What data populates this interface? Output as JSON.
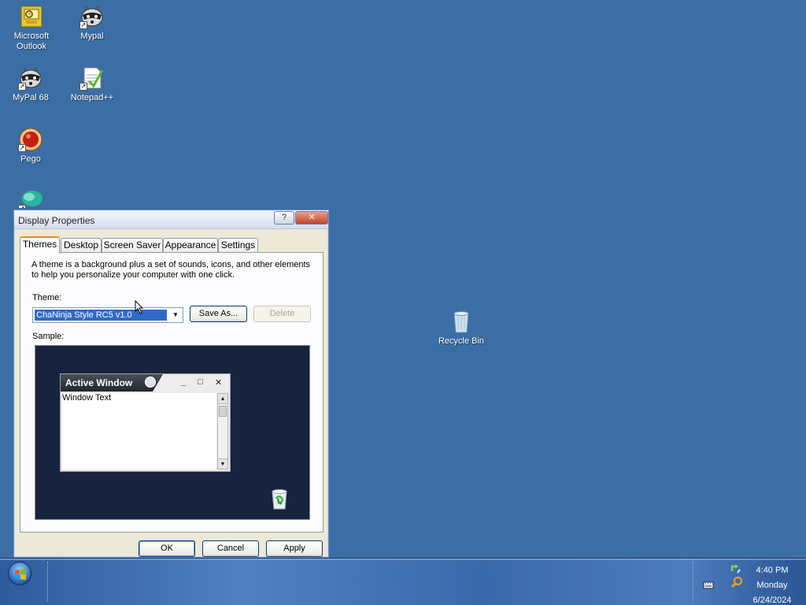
{
  "desktop": {
    "icons": [
      {
        "label_line1": "Microsoft",
        "label_line2": "Outlook"
      },
      {
        "label_line1": "Mypal",
        "label_line2": ""
      },
      {
        "label_line1": "MyPal 68",
        "label_line2": ""
      },
      {
        "label_line1": "Notepad++",
        "label_line2": ""
      },
      {
        "label_line1": "Pego",
        "label_line2": ""
      },
      {
        "label_line1": "Recycle Bin",
        "label_line2": ""
      }
    ],
    "background_color": "#3b6ea5"
  },
  "dialog": {
    "title": "Display Properties",
    "help_glyph": "?",
    "close_glyph": "✕",
    "tabs": [
      {
        "label": "Themes",
        "active": true
      },
      {
        "label": "Desktop",
        "active": false
      },
      {
        "label": "Screen Saver",
        "active": false
      },
      {
        "label": "Appearance",
        "active": false
      },
      {
        "label": "Settings",
        "active": false
      }
    ],
    "description": "A theme is a background plus a set of sounds, icons, and other elements to help you personalize your computer with one click.",
    "theme_label": "Theme:",
    "theme_value": "ChaNinja Style RC5 v1.0",
    "save_as_label": "Save As...",
    "delete_label": "Delete",
    "sample_label": "Sample:",
    "sample": {
      "active_window_title": "Active Window",
      "window_text": "Window Text",
      "min_glyph": "_",
      "max_glyph": "□",
      "close_glyph": "✕"
    },
    "ok_label": "OK",
    "cancel_label": "Cancel",
    "apply_label": "Apply"
  },
  "taskbar": {
    "time": "4:40 PM",
    "day": "Monday",
    "date": "6/24/2024"
  }
}
